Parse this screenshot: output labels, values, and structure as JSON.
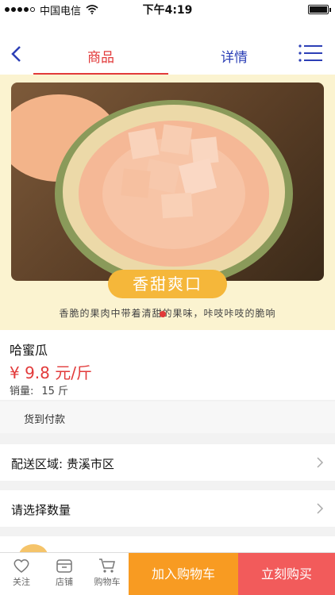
{
  "status_bar": {
    "carrier": "中国电信",
    "time": "下午4:19"
  },
  "nav": {
    "tabs": [
      "商品",
      "详情"
    ]
  },
  "hero": {
    "slogan": "香甜爽口",
    "caption": "香脆的果肉中带着清甜的果味，咔吱咔吱的脆响"
  },
  "product": {
    "name": "哈蜜瓜",
    "price": "¥ 9.8 元/斤",
    "sales_label": "销量:",
    "sales_value": "15 斤"
  },
  "payment": {
    "method": "货到付款"
  },
  "rows": {
    "delivery_area": "配送区域: 贵溪市区",
    "quantity": "请选择数量"
  },
  "tabbar": {
    "follow": "关注",
    "shop": "店铺",
    "cart": "购物车",
    "add_to_cart": "加入购物车",
    "buy_now": "立刻购买"
  },
  "colors": {
    "accent_red": "#e23a3a",
    "tab_blue": "#2c3fb6",
    "cart_orange": "#f89b22",
    "buy_red": "#f25b5b",
    "slogan_yellow": "#f5b73a"
  }
}
